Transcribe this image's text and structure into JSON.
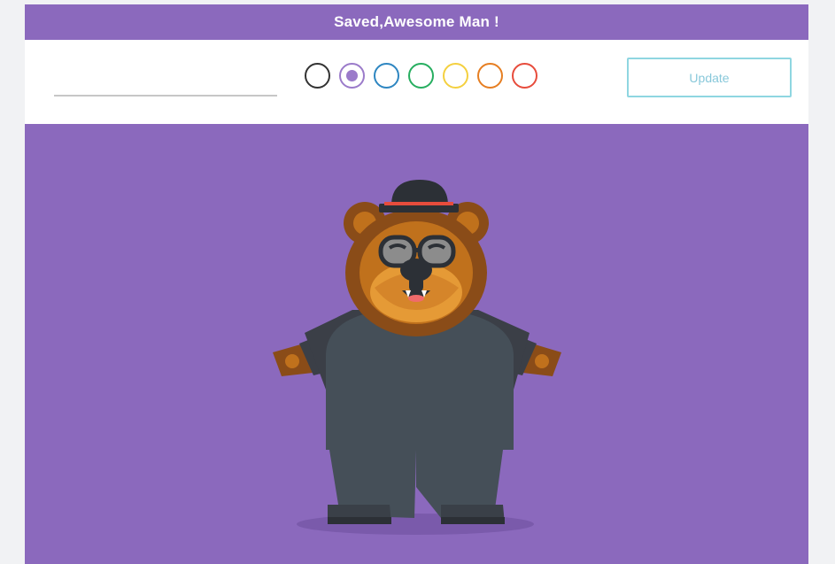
{
  "banner": {
    "message": "Saved,Awesome Man !"
  },
  "toolbar": {
    "name_input": {
      "value": "",
      "placeholder": ""
    },
    "colors": [
      {
        "name": "black",
        "hex": "#333333",
        "selected": false
      },
      {
        "name": "purple",
        "hex": "#9b7bca",
        "selected": true
      },
      {
        "name": "blue",
        "hex": "#2e86c1",
        "selected": false
      },
      {
        "name": "green",
        "hex": "#27ae60",
        "selected": false
      },
      {
        "name": "yellow",
        "hex": "#f4d03f",
        "selected": false
      },
      {
        "name": "orange",
        "hex": "#e67e22",
        "selected": false
      },
      {
        "name": "red",
        "hex": "#e74c3c",
        "selected": false
      }
    ],
    "update_label": "Update"
  },
  "theme": {
    "accent": "#8b69bd",
    "page_background": "#f1f2f4",
    "button_border": "#8fd6e1"
  },
  "character": {
    "kind": "bear",
    "icon": "bear-character-icon"
  }
}
